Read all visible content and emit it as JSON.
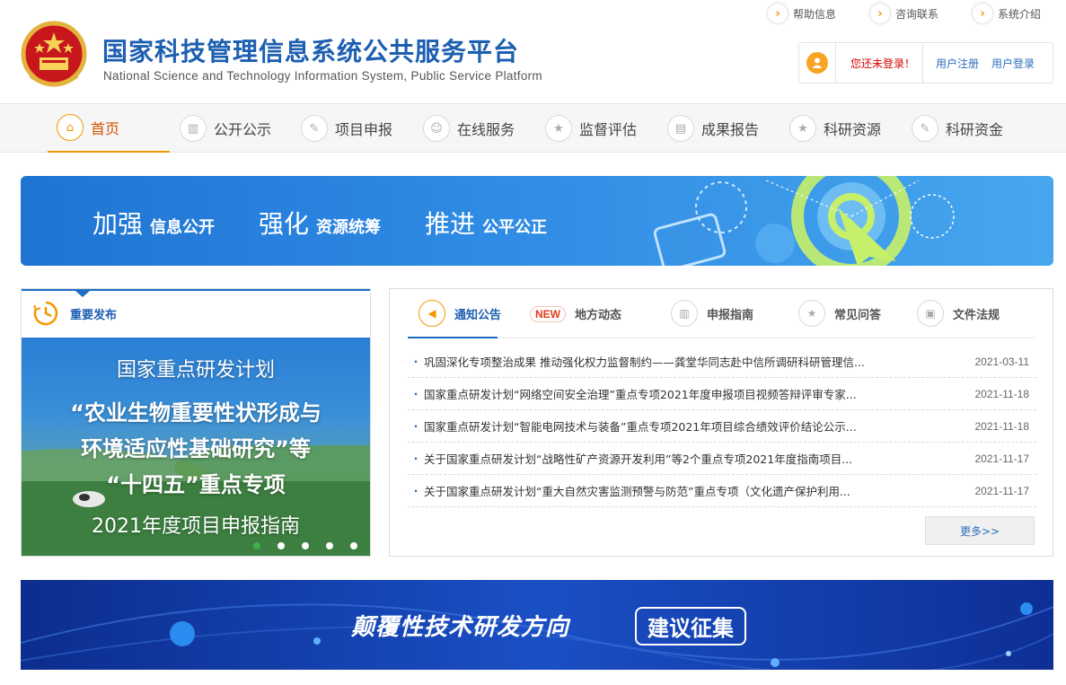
{
  "header": {
    "title": "国家科技管理信息系统公共服务平台",
    "subtitle": "National Science and Technology Information System, Public Service Platform",
    "top_links": [
      {
        "label": "帮助信息",
        "icon": "chevron-right-icon"
      },
      {
        "label": "咨询联系",
        "icon": "chevron-right-icon"
      },
      {
        "label": "系统介绍",
        "icon": "chevron-right-icon"
      }
    ],
    "login": {
      "status": "您还未登录！",
      "register_label": "用户注册",
      "login_label": "用户登录"
    }
  },
  "nav": {
    "items": [
      {
        "label": "首页",
        "icon": "home-icon",
        "active": true
      },
      {
        "label": "公开公示",
        "icon": "bar-chart-icon",
        "active": false
      },
      {
        "label": "项目申报",
        "icon": "pencil-icon",
        "active": false
      },
      {
        "label": "在线服务",
        "icon": "user-icon",
        "active": false
      },
      {
        "label": "监督评估",
        "icon": "star-icon",
        "active": false
      },
      {
        "label": "成果报告",
        "icon": "presentation-icon",
        "active": false
      },
      {
        "label": "科研资源",
        "icon": "star-icon",
        "active": false
      },
      {
        "label": "科研资金",
        "icon": "pencil-icon",
        "active": false
      }
    ]
  },
  "banner": {
    "slogans": [
      {
        "big": "加强",
        "small": "信息公开"
      },
      {
        "big": "强化",
        "small": "资源统筹"
      },
      {
        "big": "推进",
        "small": "公平公正"
      }
    ]
  },
  "release": {
    "title": "重要发布",
    "feature_lines": [
      "国家重点研发计划",
      "“农业生物重要性状形成与",
      "环境适应性基础研究”等",
      "“十四五”重点专项",
      "2021年度项目申报指南"
    ],
    "slide_count": 5,
    "active_slide": 1
  },
  "news": {
    "tabs": [
      {
        "label": "通知公告",
        "icon": "speaker-icon",
        "active": true
      },
      {
        "label": "地方动态",
        "badge": "NEW",
        "active": false
      },
      {
        "label": "申报指南",
        "icon": "bar-chart-icon",
        "active": false
      },
      {
        "label": "常见问答",
        "icon": "star-icon",
        "active": false
      },
      {
        "label": "文件法规",
        "icon": "briefcase-icon",
        "active": false
      }
    ],
    "items": [
      {
        "title": "巩固深化专项整治成果 推动强化权力监督制约——龚堂华同志赴中信所调研科研管理信...",
        "date": "2021-03-11"
      },
      {
        "title": "国家重点研发计划“网络空间安全治理”重点专项2021年度申报项目视频答辩评审专家...",
        "date": "2021-11-18"
      },
      {
        "title": "国家重点研发计划“智能电网技术与装备”重点专项2021年项目综合绩效评价结论公示...",
        "date": "2021-11-18"
      },
      {
        "title": "关于国家重点研发计划“战略性矿产资源开发利用”等2个重点专项2021年度指南项目...",
        "date": "2021-11-17"
      },
      {
        "title": "关于国家重点研发计划“重大自然灾害监测预警与防范”重点专项（文化遗产保护利用...",
        "date": "2021-11-17"
      }
    ],
    "more_label": "更多>>"
  },
  "bottom_banner": {
    "title": "颠覆性技术研发方向",
    "tag": "建议征集"
  },
  "colors": {
    "brand_blue": "#1d5fb0",
    "accent_orange": "#f39800",
    "alert_red": "#d60000"
  }
}
